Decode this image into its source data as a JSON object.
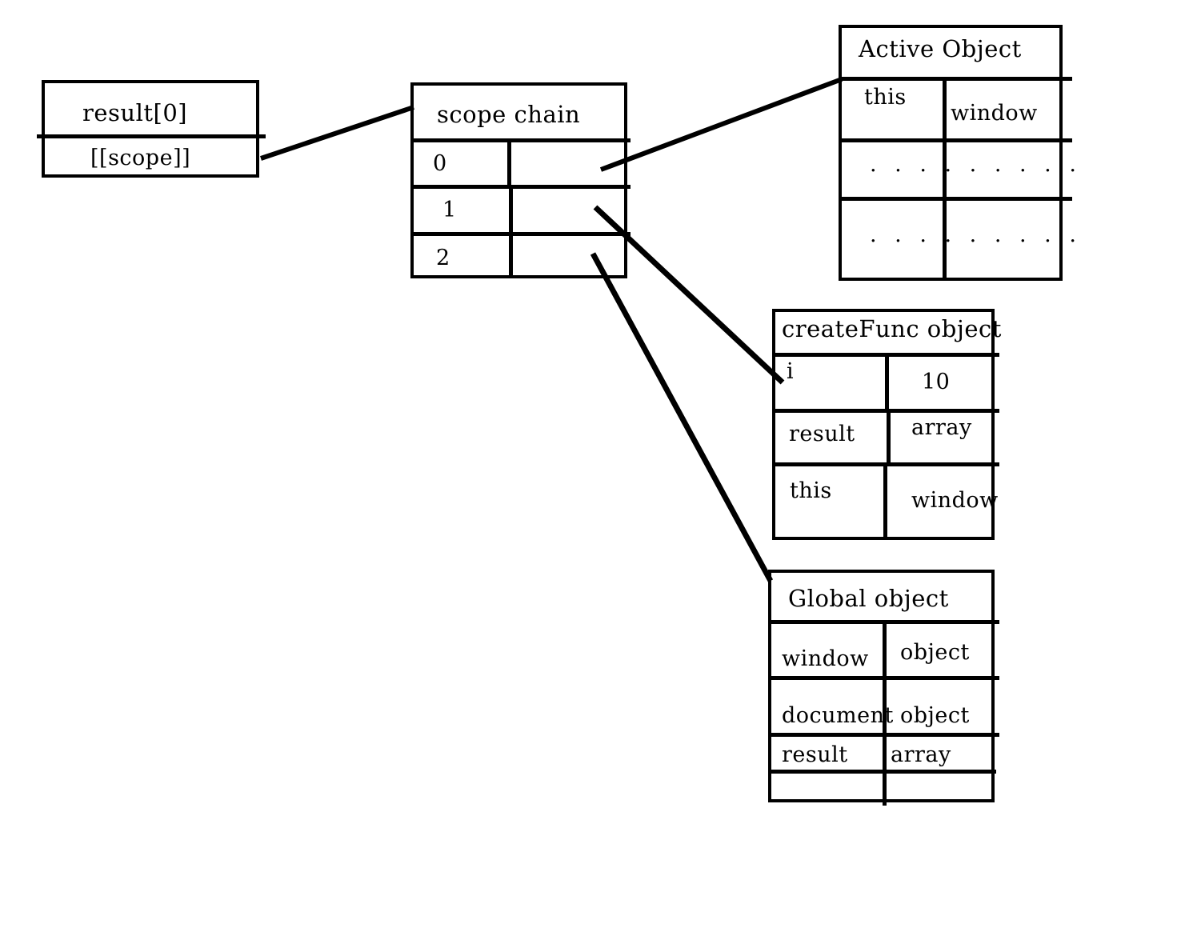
{
  "diagram": {
    "title": "JavaScript closure scope chain diagram",
    "stroke_color": "#000000",
    "background_color": "#ffffff"
  },
  "boxes": {
    "result0": {
      "header": "result[0]",
      "rows": [
        {
          "left": "[[scope]]",
          "right": ""
        }
      ]
    },
    "scope_chain": {
      "header": "scope chain",
      "rows": [
        {
          "left": "0",
          "right": ""
        },
        {
          "left": "1",
          "right": ""
        },
        {
          "left": "2",
          "right": ""
        }
      ]
    },
    "active_object": {
      "header": "Active Object",
      "rows": [
        {
          "left": "this",
          "right": "window"
        },
        {
          "left": ". . . . . . . . .",
          "right": ""
        },
        {
          "left": ". . . . . . . . .",
          "right": ""
        }
      ]
    },
    "create_func_object": {
      "header": "createFunc object",
      "rows": [
        {
          "left": "i",
          "right": "10"
        },
        {
          "left": "result",
          "right": "array"
        },
        {
          "left": "this",
          "right": "window"
        }
      ]
    },
    "global_object": {
      "header": "Global object",
      "rows": [
        {
          "left": "window",
          "right": "object"
        },
        {
          "left": "document",
          "right": "object"
        },
        {
          "left": "result",
          "right": "array"
        },
        {
          "left": "",
          "right": ""
        }
      ]
    }
  },
  "connectors": [
    {
      "name": "result0-to-scope-chain",
      "from": "result[0].[[scope]]",
      "to": "scope chain"
    },
    {
      "name": "scope-chain-0-to-active-object",
      "from": "scope chain[0]",
      "to": "Active Object"
    },
    {
      "name": "scope-chain-1-to-create-func-object",
      "from": "scope chain[1]",
      "to": "createFunc object"
    },
    {
      "name": "scope-chain-2-to-global-object",
      "from": "scope chain[2]",
      "to": "Global object"
    }
  ]
}
